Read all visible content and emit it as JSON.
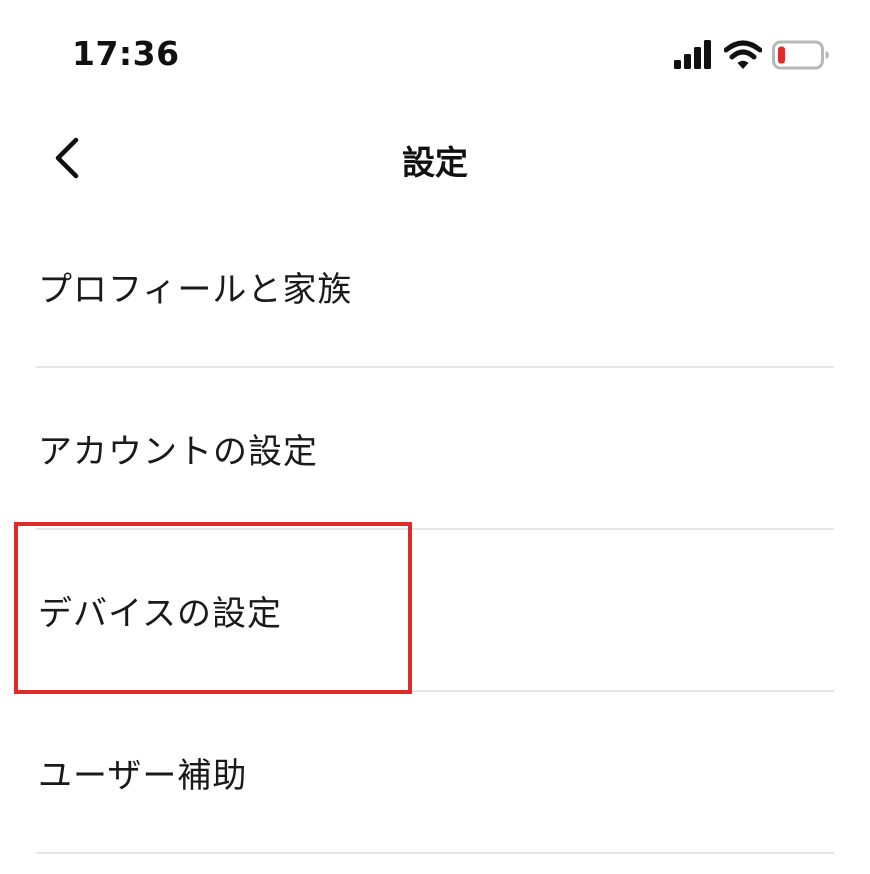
{
  "status_bar": {
    "time": "17:36",
    "icons": [
      "signal-icon",
      "wifi-icon",
      "battery-low-icon"
    ]
  },
  "nav": {
    "back_icon": "chevron-left-icon",
    "title": "設定"
  },
  "settings": {
    "items": [
      {
        "label": "プロフィールと家族"
      },
      {
        "label": "アカウントの設定"
      },
      {
        "label": "デバイスの設定",
        "highlighted": true
      },
      {
        "label": "ユーザー補助"
      }
    ]
  },
  "colors": {
    "highlight": "#e02b2b",
    "battery_low": "#e02b2b",
    "divider": "#e6e6e6",
    "text": "#111111"
  }
}
